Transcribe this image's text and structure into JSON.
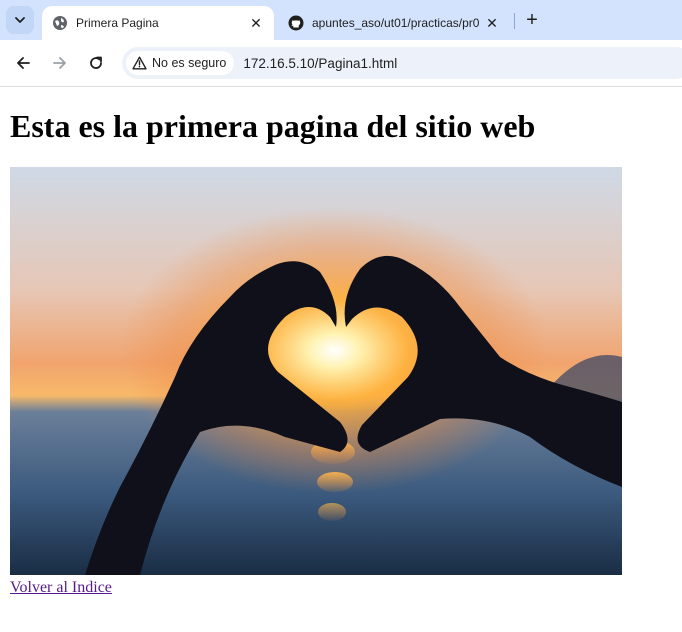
{
  "browser": {
    "tabs": [
      {
        "title": "Primera Pagina",
        "active": true,
        "icon": "globe-icon"
      },
      {
        "title": "apuntes_aso/ut01/practicas/pr0",
        "active": false,
        "icon": "github-icon"
      }
    ],
    "close_glyph": "✕",
    "new_tab_glyph": "+",
    "security_label": "No es seguro",
    "url": "172.16.5.10/Pagina1.html"
  },
  "page": {
    "heading": "Esta es la primera pagina del sitio web",
    "image": {
      "subject": "silhouette of hands forming a heart against a sunset over the sea"
    },
    "link_text": "Volver al Indice"
  },
  "colors": {
    "tabstrip": "#d3e3fd",
    "omnibox": "#edf2fa",
    "visited_link": "#551a8b"
  }
}
